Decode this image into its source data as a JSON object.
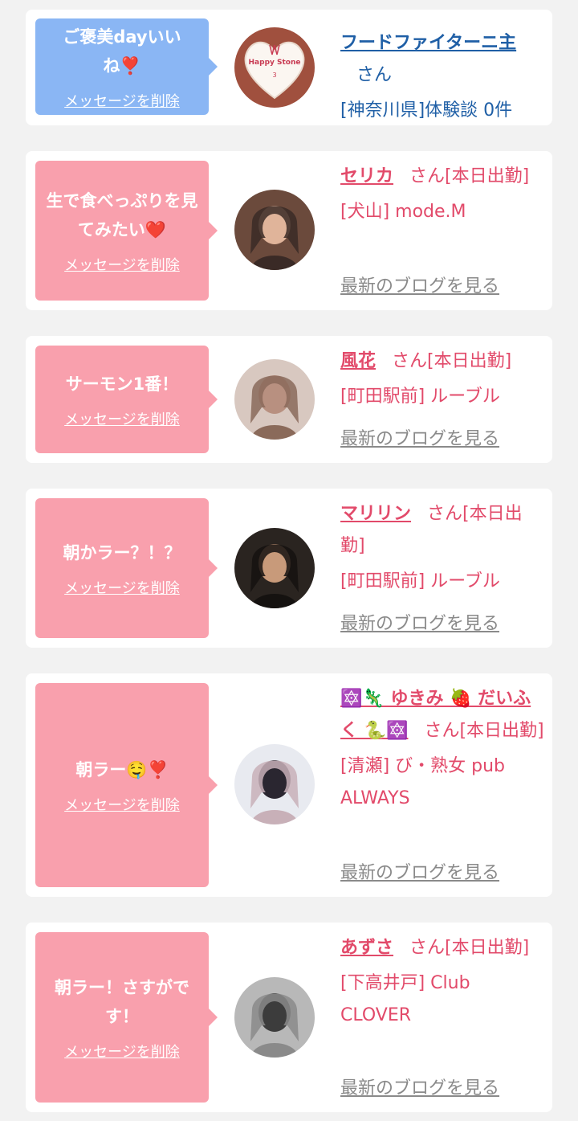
{
  "delete_label": "メッセージを削除",
  "san_label": "さん",
  "blog_label": "最新のブログを見る",
  "colors": {
    "pink_bubble": "#f9a0ad",
    "blue_bubble": "#8ab6f4",
    "pink_text": "#e24a6a",
    "blue_text": "#1f5fa6"
  },
  "cards": [
    {
      "bubble_color": "blue",
      "message": "ご褒美dayいいね❣️",
      "name": "フードファイターニ主",
      "status": "",
      "shop": "[神奈川県]体験談 0件",
      "avatar_icon": "heart-cake-avatar-icon",
      "avatar_caption": "Happy Stone",
      "has_blog_link": false
    },
    {
      "bubble_color": "pink",
      "message": "生で食べっぷりを見てみたい❤️",
      "name": "セリカ",
      "status": "[本日出勤]",
      "shop": "[犬山] mode.M",
      "avatar_icon": "woman-photo-avatar-icon",
      "has_blog_link": true
    },
    {
      "bubble_color": "pink",
      "message": "サーモン1番！",
      "name": "風花",
      "status": "[本日出勤]",
      "shop": "[町田駅前] ルーブル",
      "avatar_icon": "woman-photo-avatar-icon",
      "has_blog_link": true
    },
    {
      "bubble_color": "pink",
      "message": "朝かラー？！？",
      "name": "マリリン",
      "status": "[本日出勤]",
      "shop": "[町田駅前] ルーブル",
      "avatar_icon": "woman-photo-avatar-icon",
      "has_blog_link": true
    },
    {
      "bubble_color": "pink",
      "message": "朝ラー🤤❣️",
      "name": "🔯🦎 ゆきみ 🍓 だいふく 🐍🔯",
      "status": "[本日出勤]",
      "shop": "[清瀬] び・熟女 pub ALWAYS",
      "avatar_icon": "woman-photo-avatar-icon",
      "has_blog_link": true
    },
    {
      "bubble_color": "pink",
      "message": "朝ラー！さすがです！",
      "name": "あずさ",
      "status": "[本日出勤]",
      "shop": "[下高井戸] Club CLOVER",
      "avatar_icon": "woman-photo-avatar-icon",
      "has_blog_link": true
    }
  ]
}
